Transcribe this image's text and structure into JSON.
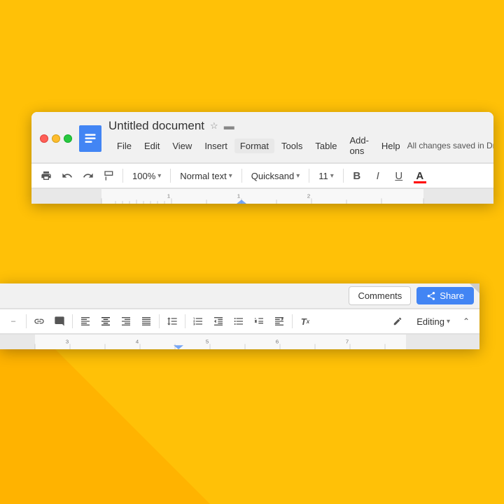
{
  "background": {
    "color": "#FFC107"
  },
  "window_top": {
    "title": "Untitled document",
    "traffic_lights": [
      "red",
      "yellow",
      "green"
    ],
    "menu_items": [
      "File",
      "Edit",
      "View",
      "Insert",
      "Format",
      "Tools",
      "Table",
      "Add-ons",
      "Help"
    ],
    "saved_status": "All changes saved in Dri",
    "toolbar": {
      "zoom": "100%",
      "style": "Normal text",
      "font": "Quicksand",
      "size": "11",
      "bold": "B",
      "italic": "I",
      "underline": "U",
      "font_color": "A"
    }
  },
  "window_bottom": {
    "buttons": {
      "comments": "Comments",
      "share": "Share"
    },
    "toolbar": {
      "editing": "Editing"
    }
  },
  "icons": {
    "star": "☆",
    "folder": "▬",
    "print": "🖨",
    "undo": "↩",
    "redo": "↪",
    "paint_format": "🖌",
    "dropdown_arrow": "▾",
    "pencil": "✎",
    "share_people": "👤",
    "chevron_up": "⌃",
    "link": "🔗",
    "indent_left": "⇤",
    "indent_right": "⇥"
  }
}
